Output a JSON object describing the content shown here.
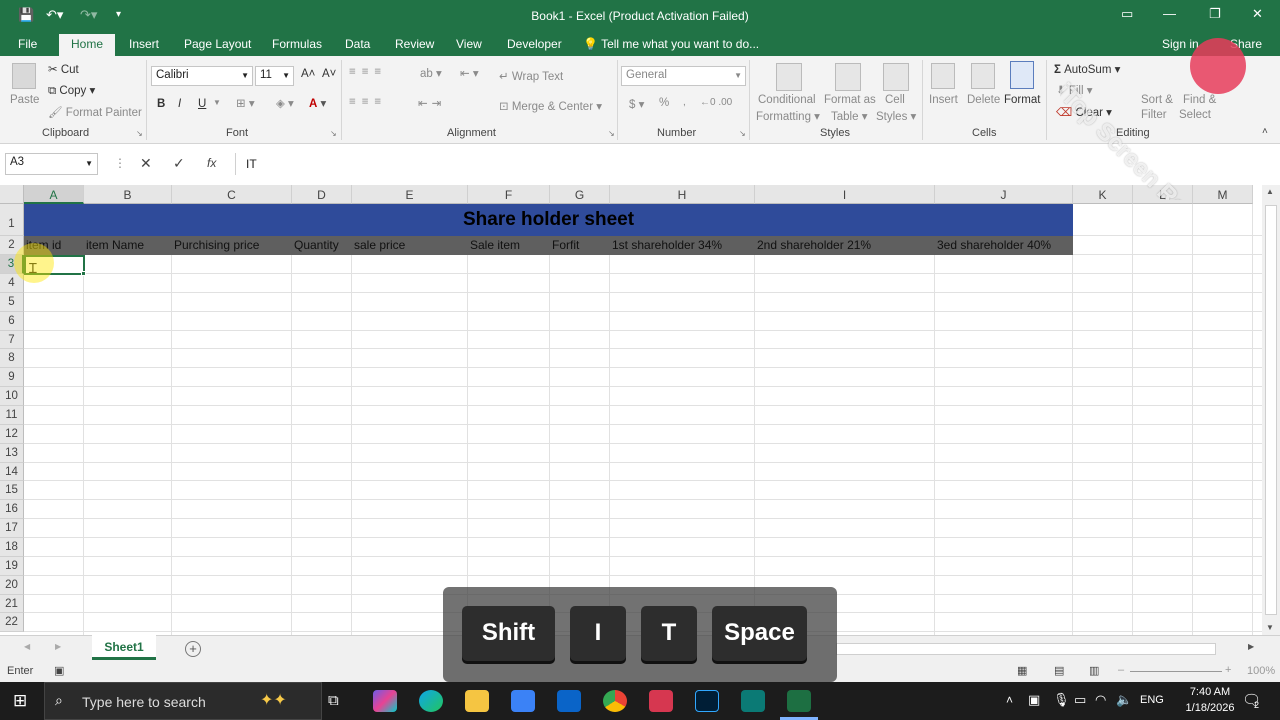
{
  "title": "Book1 - Excel (Product Activation Failed)",
  "tabs": [
    "File",
    "Home",
    "Insert",
    "Page Layout",
    "Formulas",
    "Data",
    "Review",
    "View",
    "Developer"
  ],
  "tell_me": "Tell me what you want to do...",
  "sign_in": "Sign in",
  "share": "Share",
  "ribbon": {
    "clipboard": {
      "paste": "Paste",
      "cut": "Cut",
      "copy": "Copy",
      "format_painter": "Format Painter",
      "label": "Clipboard"
    },
    "font": {
      "name": "Calibri",
      "size": "11",
      "bold": "B",
      "italic": "I",
      "underline": "U",
      "label": "Font"
    },
    "alignment": {
      "wrap_text": "Wrap Text",
      "merge_center": "Merge & Center",
      "label": "Alignment"
    },
    "number": {
      "format": "General",
      "currency": "$",
      "percent": "%",
      "label": "Number"
    },
    "styles": {
      "conditional": "Conditional",
      "formatting": "Formatting",
      "format_as": "Format as",
      "table": "Table",
      "cell": "Cell",
      "styles_word": "Styles",
      "label": "Styles"
    },
    "cells": {
      "insert": "Insert",
      "delete": "Delete",
      "format": "Format",
      "label": "Cells"
    },
    "editing": {
      "autosum": "AutoSum",
      "fill": "Fill",
      "clear": "Clear",
      "sort": "Sort &",
      "filter": "Filter",
      "find": "Find &",
      "select": "Select",
      "label": "Editing"
    }
  },
  "formula_bar": {
    "name_box": "A3",
    "cancel": "✕",
    "enter": "✓",
    "fx": "fx",
    "value": "IT"
  },
  "columns": [
    "A",
    "B",
    "C",
    "D",
    "E",
    "F",
    "G",
    "H",
    "I",
    "J",
    "K",
    "L",
    "M"
  ],
  "rows": [
    "1",
    "2",
    "3",
    "4",
    "5",
    "6",
    "7",
    "8",
    "9",
    "10",
    "11",
    "12",
    "13",
    "14",
    "15",
    "16",
    "17",
    "18",
    "19",
    "20",
    "21",
    "22"
  ],
  "sheet": {
    "title": "Share holder sheet",
    "headers": [
      "item id",
      "item Name",
      "Purchising price",
      "Quantity",
      "sale price",
      "Sale item",
      "Forfit",
      "1st shareholder 34%",
      "2nd shareholder 21%",
      "3ed shareholder 40%"
    ]
  },
  "sheet_tab": "Sheet1",
  "status": {
    "mode": "Enter",
    "zoom": "100%"
  },
  "keys": [
    "Shift",
    "I",
    "T",
    "Space"
  ],
  "taskbar": {
    "search": "Type here to search",
    "lang": "ENG",
    "time": "7:40 AM",
    "date": "1/18/2026",
    "notif": "2"
  },
  "watermark": "iTop Screen Recorder",
  "colors": {
    "excel_green": "#217346",
    "title_fill": "#2f4b9a",
    "header_fill": "#5f5f5f"
  }
}
